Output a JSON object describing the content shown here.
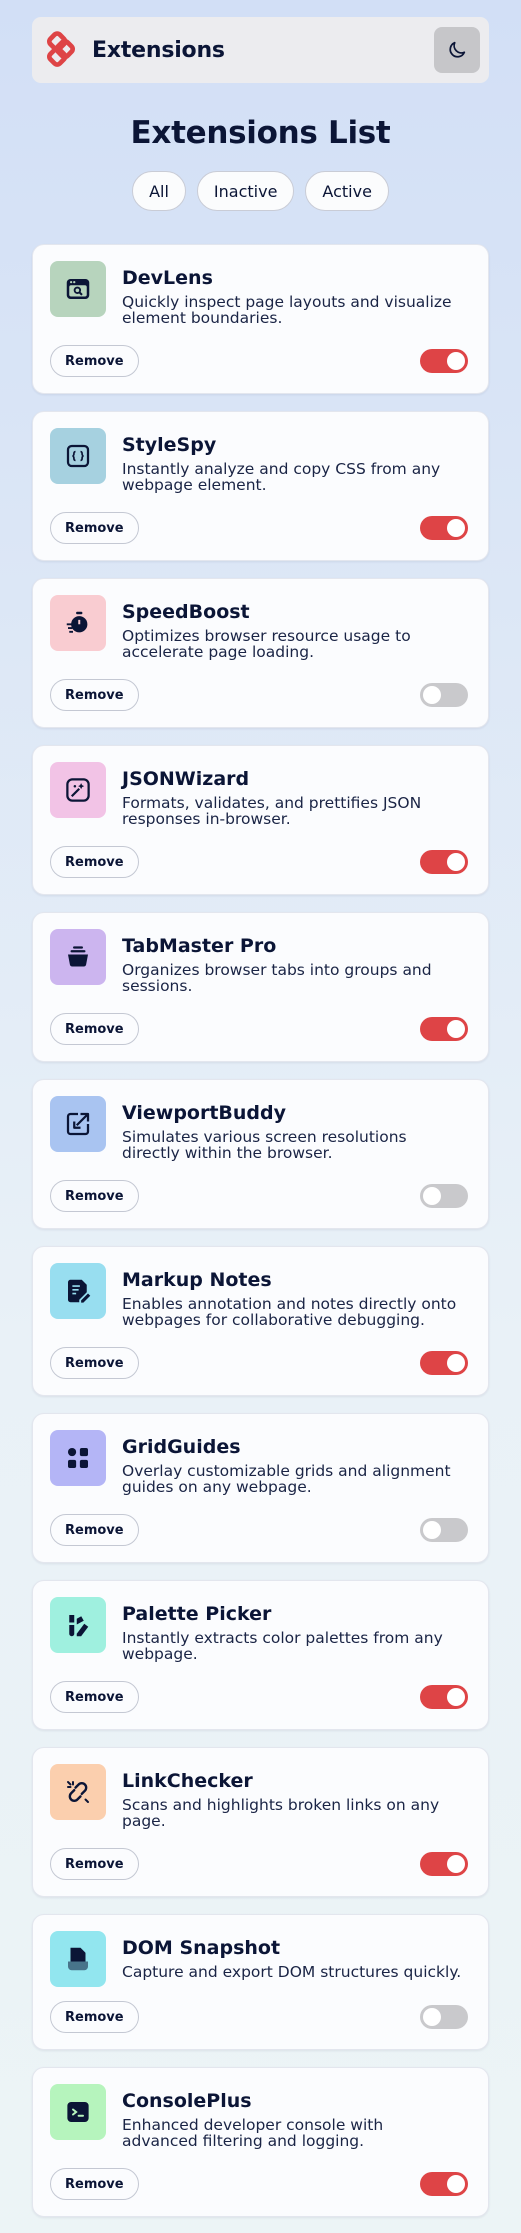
{
  "header": {
    "app_name": "Extensions",
    "logo_icon": "brand-logo-icon",
    "theme_icon": "moon-icon",
    "accent_color": "#de4446"
  },
  "main": {
    "title": "Extensions List",
    "filters": [
      {
        "label": "All"
      },
      {
        "label": "Inactive"
      },
      {
        "label": "Active"
      }
    ],
    "remove_label": "Remove"
  },
  "extensions": [
    {
      "name": "DevLens",
      "description": "Quickly inspect page layouts and visualize element boundaries.",
      "active": true,
      "icon": "devlens-icon",
      "icon_bg": "#b7d4bd"
    },
    {
      "name": "StyleSpy",
      "description": "Instantly analyze and copy CSS from any webpage element.",
      "active": true,
      "icon": "stylespy-icon",
      "icon_bg": "#a6d1e0"
    },
    {
      "name": "SpeedBoost",
      "description": "Optimizes browser resource usage to accelerate page loading.",
      "active": false,
      "icon": "speedboost-icon",
      "icon_bg": "#f9ccd1"
    },
    {
      "name": "JSONWizard",
      "description": "Formats, validates, and prettifies JSON responses in-browser.",
      "active": true,
      "icon": "jsonwizard-icon",
      "icon_bg": "#f2c3e6"
    },
    {
      "name": "TabMaster Pro",
      "description": "Organizes browser tabs into groups and sessions.",
      "active": true,
      "icon": "tabmaster-icon",
      "icon_bg": "#ccb5ef"
    },
    {
      "name": "ViewportBuddy",
      "description": "Simulates various screen resolutions directly within the browser.",
      "active": false,
      "icon": "viewportbuddy-icon",
      "icon_bg": "#a9c4f1"
    },
    {
      "name": "Markup Notes",
      "description": "Enables annotation and notes directly onto webpages for collaborative debugging.",
      "active": true,
      "icon": "markup-notes-icon",
      "icon_bg": "#98def0"
    },
    {
      "name": "GridGuides",
      "description": "Overlay customizable grids and alignment guides on any webpage.",
      "active": false,
      "icon": "gridguides-icon",
      "icon_bg": "#b4b5f6"
    },
    {
      "name": "Palette Picker",
      "description": "Instantly extracts color palettes from any webpage.",
      "active": true,
      "icon": "palette-picker-icon",
      "icon_bg": "#9ff0df"
    },
    {
      "name": "LinkChecker",
      "description": "Scans and highlights broken links on any page.",
      "active": true,
      "icon": "linkchecker-icon",
      "icon_bg": "#fbcfae"
    },
    {
      "name": "DOM Snapshot",
      "description": "Capture and export DOM structures quickly.",
      "active": false,
      "icon": "dom-snapshot-icon",
      "icon_bg": "#92e6ef"
    },
    {
      "name": "ConsolePlus",
      "description": "Enhanced developer console with advanced filtering and logging.",
      "active": true,
      "icon": "consoleplus-icon",
      "icon_bg": "#b6f4bd"
    }
  ]
}
